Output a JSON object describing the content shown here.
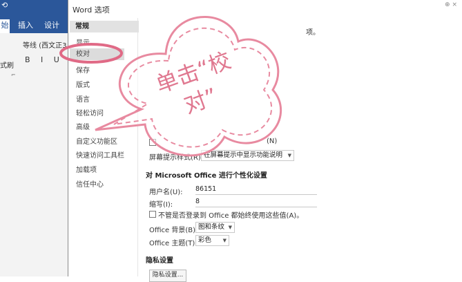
{
  "word": {
    "tabs": [
      "始",
      "插入",
      "设计"
    ],
    "font_name": "等线 (西文正3",
    "format_buttons": "B I U",
    "format_painter": "式刷"
  },
  "dialog": {
    "title": "Word 选项",
    "close_label": "⊕ ×",
    "nav": [
      "常规",
      "显示",
      "校对",
      "保存",
      "版式",
      "语言",
      "轻松访问",
      "高级",
      "自定义功能区",
      "快速访问工具栏",
      "加载项",
      "信任中心"
    ],
    "partial_top": "项。",
    "screentip_partial": "(N)",
    "screentip_label": "屏幕提示样式(R):",
    "screentip_value": "在屏幕提示中显示功能说明",
    "personalize_title": "对 Microsoft Office 进行个性化设置",
    "username_label": "用户名(U):",
    "username_value": "86151",
    "initials_label": "缩写(I):",
    "initials_value": "8",
    "always_use_label": "不管是否登录到 Office 都始终使用这些值(A)。",
    "background_label": "Office 背景(B):",
    "background_value": "图和条纹",
    "theme_label": "Office 主题(T):",
    "theme_value": "彩色",
    "privacy_title": "隐私设置",
    "privacy_button": "隐私设置..."
  },
  "annotation": {
    "line1": "单击“校",
    "line2": "对”",
    "color": "#e07890"
  }
}
